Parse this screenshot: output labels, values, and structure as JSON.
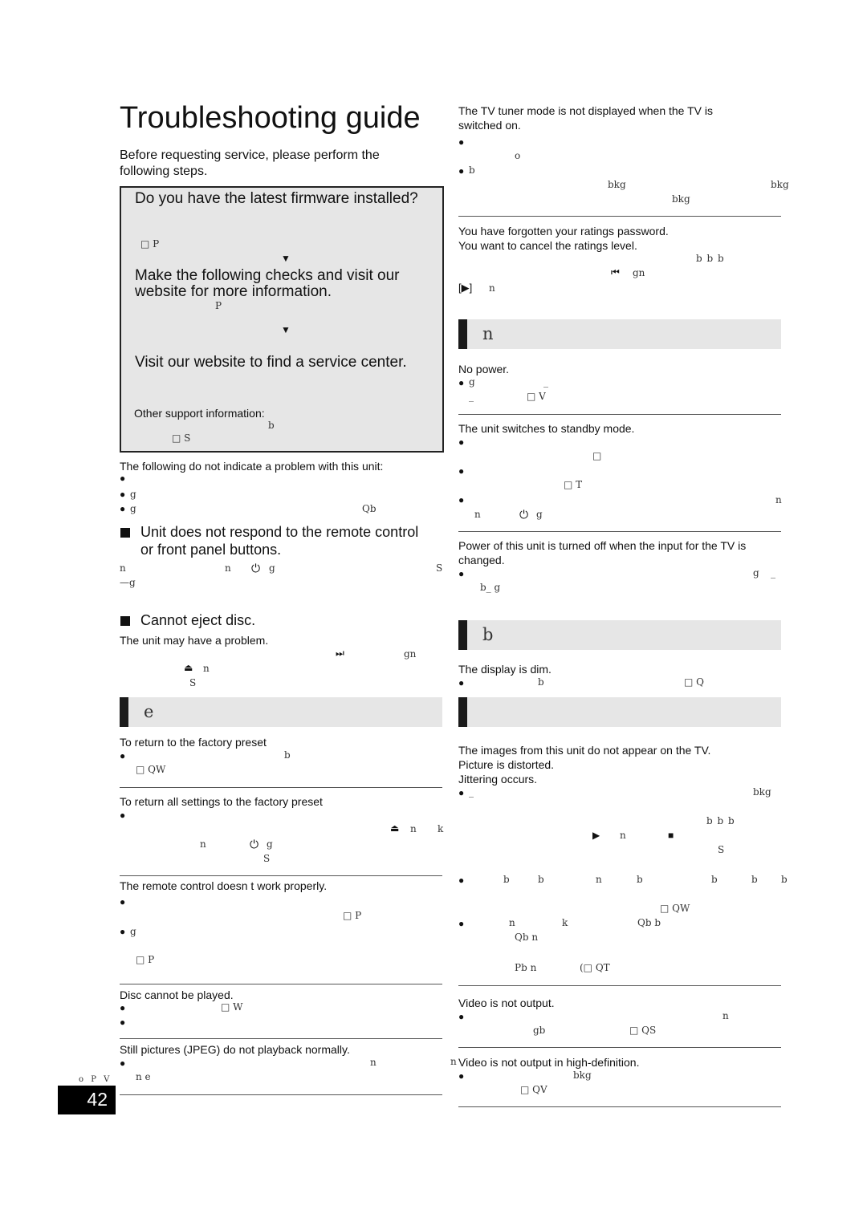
{
  "title": "Troubleshooting guide",
  "intro": [
    "Before requesting service, please perform the",
    "following steps."
  ],
  "box": {
    "q1": "Do you have the latest firmware installed?",
    "ref1": "□ P",
    "arrow": "▼",
    "q2": [
      "Make the following checks and visit our",
      "website for more information."
    ],
    "ref2": "P",
    "q3": "Visit our website to find a service center.",
    "other": "Other support information:",
    "frag_b": "b",
    "ref3": "□ S"
  },
  "left": {
    "note": "The following do not indicate a problem with this unit:",
    "note_frags": [
      "g",
      "g",
      "Qb"
    ],
    "h1": [
      "Unit does not respond to the remote control",
      "or front panel buttons."
    ],
    "h1_frags": [
      "n",
      "n",
      "⏻",
      "g",
      "S",
      "—g"
    ],
    "h2": "Cannot eject disc.",
    "h2_text": "The unit may have a problem.",
    "h2_frags": [
      "⏭",
      "gn",
      "⏏",
      "n",
      "S"
    ],
    "section_e": "e",
    "reset1": "To return to the factory preset",
    "reset1_frags": [
      "b",
      "□ QW"
    ],
    "reset2": "To return all settings to the factory preset",
    "reset2_frags": [
      "⏏",
      "n",
      "k",
      "n",
      "⏻",
      "g",
      "S"
    ],
    "remote": "The remote control doesn t work properly.",
    "remote_frags": [
      "□ P",
      "g",
      "□ P"
    ],
    "disc": "Disc cannot be played.",
    "disc_frags": [
      "□ W"
    ],
    "jpeg": "Still pictures (JPEG) do not playback normally.",
    "jpeg_frags": [
      "n",
      "n e"
    ]
  },
  "footer": {
    "label": "o P V",
    "page_number": "42"
  },
  "right": {
    "tuner": [
      "The TV tuner mode is not displayed when the TV is",
      "switched on."
    ],
    "tuner_frags": [
      "o",
      "b",
      "bkg",
      "bkg",
      "bkg"
    ],
    "password": [
      "You have forgotten your ratings password.",
      "You want to cancel the ratings level."
    ],
    "password_frags": [
      "b b b",
      "⏮",
      "gn",
      "[▶]",
      "n"
    ],
    "section_n": "n",
    "nopower": "No power.",
    "nopower_frags": [
      "g",
      "_",
      "_",
      "□ V"
    ],
    "standby": "The unit switches to standby mode.",
    "standby_frags": [
      "□",
      "□ T",
      "n",
      "n",
      "⏻",
      "g"
    ],
    "input": [
      "Power of this unit is turned off when the input for the TV is",
      "changed."
    ],
    "input_frags": [
      "g",
      "_",
      "b_ g"
    ],
    "section_b": "b",
    "dim": "The display is dim.",
    "dim_frags": [
      "b",
      "□ Q"
    ],
    "images": [
      "The images from this unit do not appear on the TV.",
      "Picture is distorted.",
      "Jittering occurs."
    ],
    "images_frags": [
      "_",
      "bkg",
      "b b b",
      "▶",
      "n",
      "■",
      "S",
      "b",
      "b",
      "n",
      "b",
      "b",
      "b",
      "b",
      "□ QW",
      "n",
      "k",
      "Qb b",
      "Qb n",
      "Pb n",
      "(□ QT"
    ],
    "video": "Video is not output.",
    "video_frags": [
      "n",
      "gb",
      "□ QS"
    ],
    "hd_prefix": "n",
    "hd": "Video is not output in high-definition.",
    "hd_frags": [
      "bkg",
      "□ QV"
    ]
  }
}
